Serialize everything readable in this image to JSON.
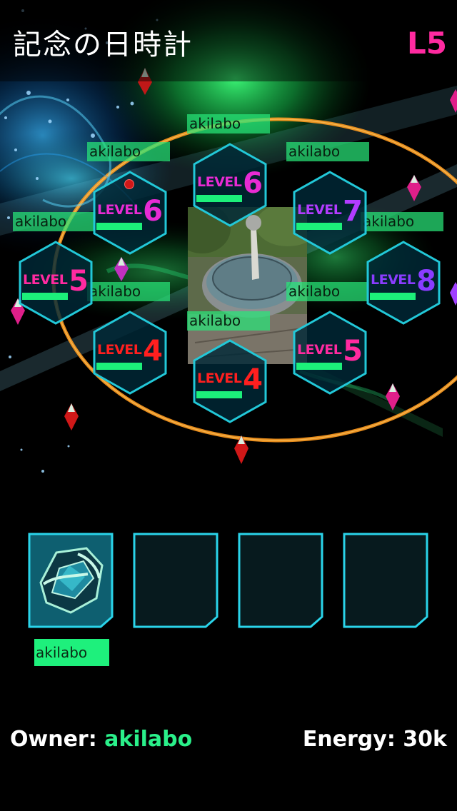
{
  "portal": {
    "name": "記念の日時計",
    "level": "L5"
  },
  "colors": {
    "level_pink": "#ff2aa0",
    "level_purple": "#b23cff",
    "level_red": "#ff1f1f",
    "level_magenta": "#e82bd4",
    "level_violet": "#8a3cff",
    "hex_border": "#22c8d8",
    "owner_green": "#2af08a"
  },
  "resonators": [
    {
      "slot": "n",
      "label": "LEVEL",
      "level": "6",
      "owner": "akilabo",
      "color": "#e82bd4"
    },
    {
      "slot": "nw",
      "label": "LEVEL",
      "level": "6",
      "owner": "akilabo",
      "color": "#e82bd4",
      "marker": "red-dot-icon"
    },
    {
      "slot": "ne",
      "label": "LEVEL",
      "level": "7",
      "owner": "akilabo",
      "color": "#b23cff"
    },
    {
      "slot": "w",
      "label": "LEVEL",
      "level": "5",
      "owner": "akilabo",
      "color": "#ff2aa0"
    },
    {
      "slot": "e",
      "label": "LEVEL",
      "level": "8",
      "owner": "akilabo",
      "color": "#8a3cff"
    },
    {
      "slot": "sw",
      "label": "LEVEL",
      "level": "4",
      "owner": "akilabo",
      "color": "#ff1f1f"
    },
    {
      "slot": "se",
      "label": "LEVEL",
      "level": "5",
      "owner": "akilabo",
      "color": "#ff2aa0"
    },
    {
      "slot": "s",
      "label": "LEVEL",
      "level": "4",
      "owner": "akilabo",
      "color": "#ff1f1f"
    }
  ],
  "mods": [
    {
      "filled": true,
      "icon": "shield-mod-icon",
      "owner": "akilabo"
    },
    {
      "filled": false
    },
    {
      "filled": false
    },
    {
      "filled": false
    }
  ],
  "footer": {
    "owner_label": "Owner:",
    "owner_name": "akilabo",
    "energy_label": "Energy:",
    "energy_value": "30k"
  }
}
